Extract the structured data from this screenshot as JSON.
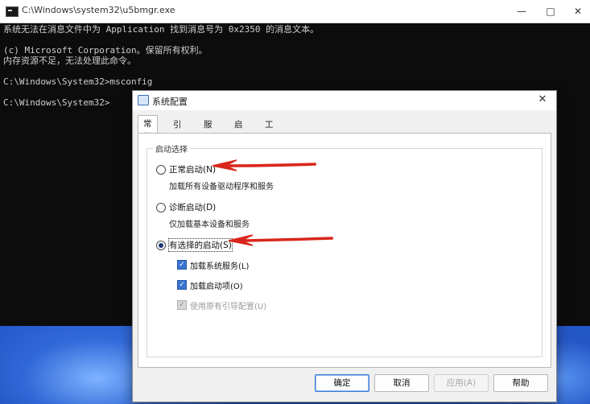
{
  "console": {
    "title": "C:\\Windows\\system32\\u5bmgr.exe",
    "lines": [
      "系统无法在消息文件中为 Application 找到消息号为 0x2350 的消息文本。",
      "",
      "(c) Microsoft Corporation。保留所有权利。",
      "内存资源不足，无法处理此命令。",
      "",
      "C:\\Windows\\System32>msconfig",
      "",
      "C:\\Windows\\System32>"
    ],
    "controls": {
      "minimize": "—",
      "maximize": "□",
      "close": "✕"
    }
  },
  "dialog": {
    "title": "系统配置",
    "close": "✕",
    "tabs": [
      "常规",
      "引导",
      "服务",
      "启动",
      "工具"
    ],
    "active_tab": 0,
    "group_label": "启动选择",
    "options": [
      {
        "label": "正常启动(N)",
        "desc": "加载所有设备驱动程序和服务",
        "checked": false
      },
      {
        "label": "诊断启动(D)",
        "desc": "仅加载基本设备和服务",
        "checked": false
      },
      {
        "label": "有选择的启动(S)",
        "checked": true
      }
    ],
    "selective_items": [
      {
        "label": "加载系统服务(L)",
        "checked": true,
        "enabled": true
      },
      {
        "label": "加载启动项(O)",
        "checked": true,
        "enabled": true
      },
      {
        "label": "使用原有引导配置(U)",
        "checked": true,
        "enabled": false
      }
    ],
    "buttons": [
      {
        "label": "确定",
        "default": true,
        "enabled": true
      },
      {
        "label": "取消",
        "default": false,
        "enabled": true
      },
      {
        "label": "应用(A)",
        "default": false,
        "enabled": false
      },
      {
        "label": "帮助",
        "default": false,
        "enabled": true
      }
    ]
  },
  "colors": {
    "arrow": "#d9261c",
    "console_bg": "#0c0c0c",
    "console_text": "#cfcfcf",
    "accent": "#3874d0"
  },
  "icons": {
    "console": "console-app-icon",
    "dialog": "msconfig-icon",
    "checkmark": "✓"
  }
}
